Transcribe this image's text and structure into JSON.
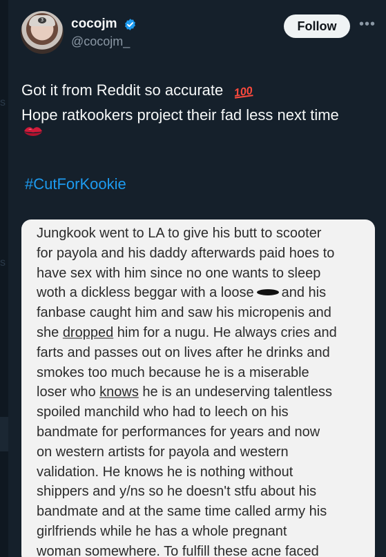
{
  "colors": {
    "background": "#15202b",
    "accent": "#1d9bf0",
    "text": "#f7f9f9",
    "muted": "#8b98a5",
    "verified_badge": "#1d9bf0"
  },
  "tweet": {
    "author": {
      "display_name": "cocojm",
      "handle": "@cocojm_",
      "verified_icon": "verified-badge-icon"
    },
    "follow_label": "Follow",
    "more_icon": "more-options-icon",
    "more_glyph": "•••",
    "text_lines": [
      "Got it from Reddit so accurate",
      "Hope ratkookers project their fad less next time"
    ],
    "emoji_100": "100",
    "lips_icon": "lips-emoji-icon",
    "hashtag": "#CutForKookie"
  },
  "media": {
    "lines": [
      [
        "Jungkook went to LA to give his butt to scooter"
      ],
      [
        "for payola and his daddy afterwards paid hoes to"
      ],
      [
        "have sex with him since no one wants to sleep"
      ],
      [
        "woth a dickless beggar with a loose",
        "and his"
      ],
      [
        "fanbase caught him and saw his micropenis and"
      ],
      [
        "she ",
        "dropped",
        " him for a nugu. He always cries and"
      ],
      [
        "farts and passes out on lives after he drinks and"
      ],
      [
        "smokes too much because he is a miserable"
      ],
      [
        "loser who ",
        "knows",
        " he is an undeserving talentless"
      ],
      [
        "spoiled manchild who had to leech on his"
      ],
      [
        "bandmate for performances for years and now"
      ],
      [
        "on western artists for payola and western"
      ],
      [
        "validation. He knows he is nothing without"
      ],
      [
        "shippers and y/ns so he doesn't stfu about his"
      ],
      [
        "bandmate and at the same time called army his"
      ],
      [
        "girlfriends while he has a whole pregnant"
      ],
      [
        "woman somewhere. To fulfill these acne faced"
      ]
    ]
  }
}
